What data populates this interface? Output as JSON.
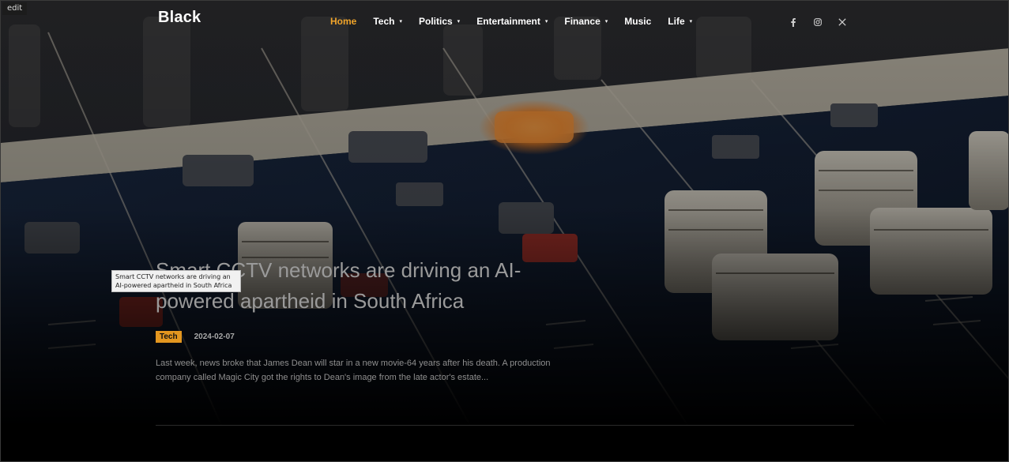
{
  "edit_label": "edit",
  "header": {
    "logo": "Black",
    "nav": [
      {
        "label": "Home",
        "active": true,
        "has_submenu": false
      },
      {
        "label": "Tech",
        "active": false,
        "has_submenu": true
      },
      {
        "label": "Politics",
        "active": false,
        "has_submenu": true
      },
      {
        "label": "Entertainment",
        "active": false,
        "has_submenu": true
      },
      {
        "label": "Finance",
        "active": false,
        "has_submenu": true
      },
      {
        "label": "Music",
        "active": false,
        "has_submenu": false
      },
      {
        "label": "Life",
        "active": false,
        "has_submenu": true
      }
    ],
    "social": [
      "facebook-icon",
      "instagram-icon",
      "x-icon"
    ]
  },
  "article": {
    "headline": "Smart CCTV networks are driving an AI-powered apartheid in South Africa",
    "tooltip": "Smart CCTV networks are driving an AI-powered apartheid in South Africa",
    "category": "Tech",
    "date": "2024-02-07",
    "excerpt": "Last week, news broke that James Dean will star in a new movie-64 years after his death. A production company called Magic City got the rights to Dean's image from the late actor's estate..."
  },
  "colors": {
    "accent": "#f0a42a",
    "tag_bg": "#e3961f",
    "background": "#000000"
  }
}
